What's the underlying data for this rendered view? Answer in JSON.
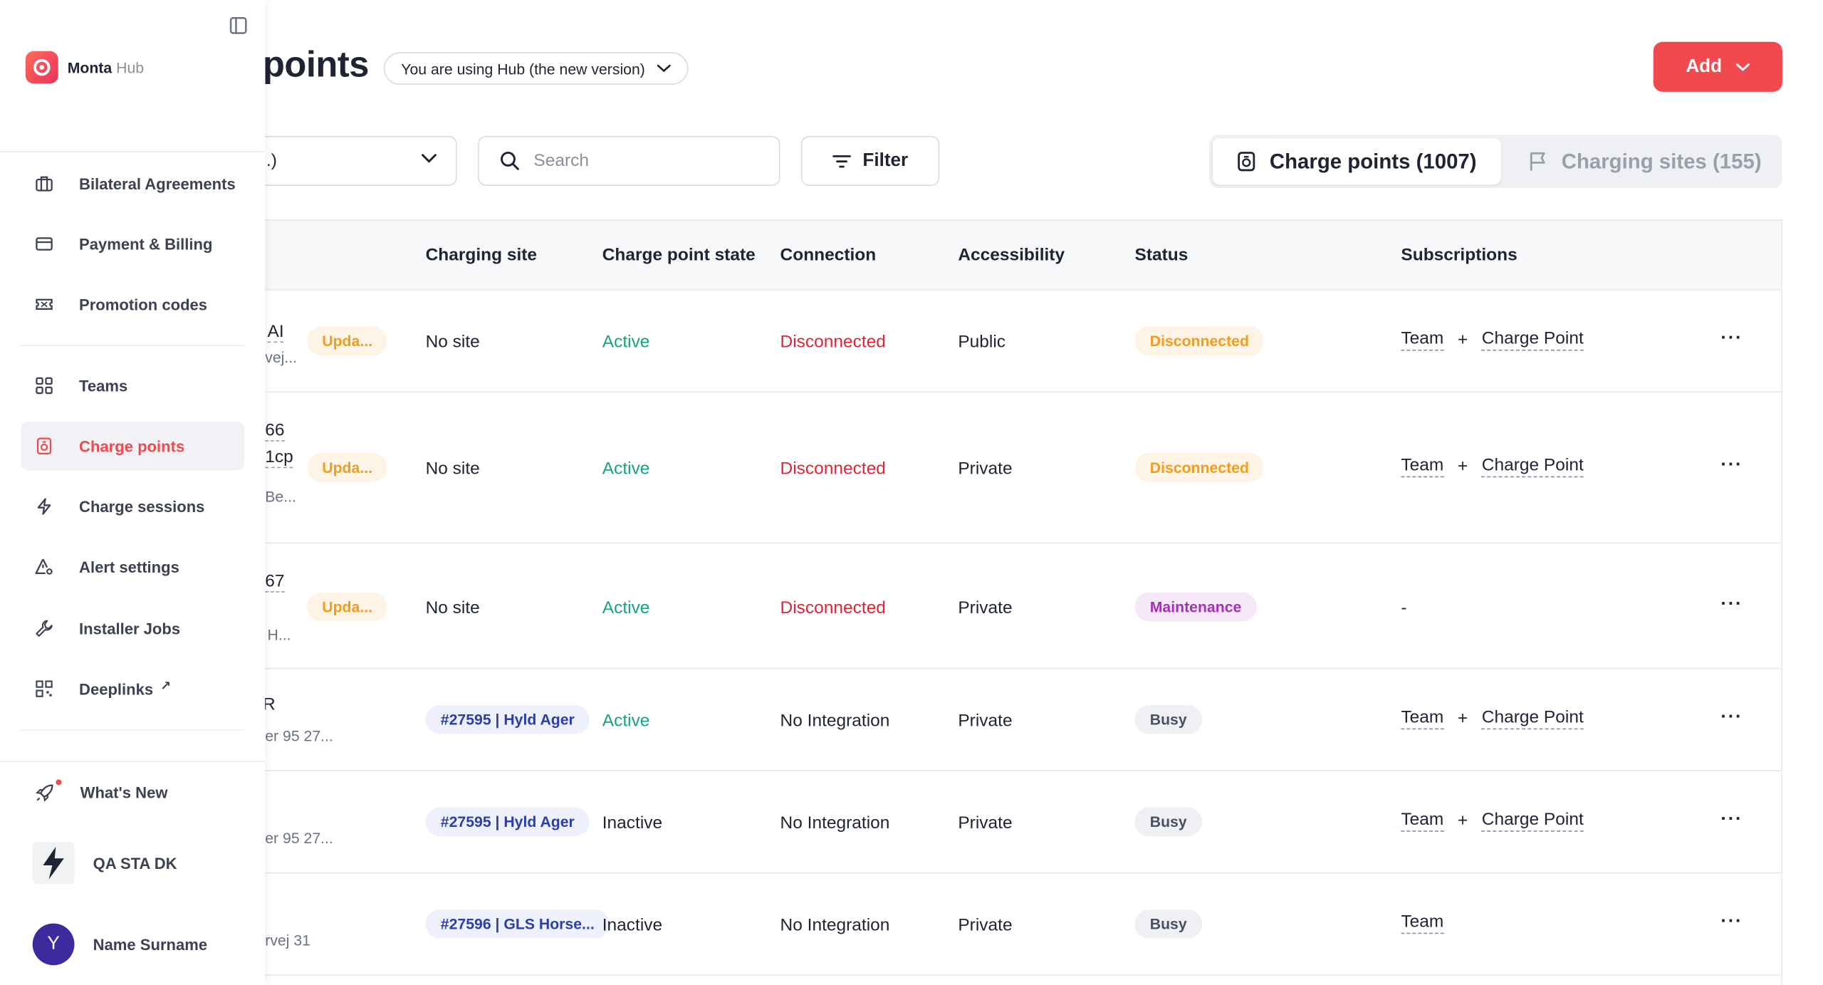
{
  "header": {
    "title": "points",
    "version_label": "You are using Hub (the new version)",
    "add_label": "Add"
  },
  "toolbar": {
    "select_value": ".)",
    "search_placeholder": "Search",
    "filter_label": "Filter",
    "tab_charge_points": "Charge points (1007)",
    "tab_charging_sites": "Charging sites (155)"
  },
  "table": {
    "columns": [
      "Charging site",
      "Charge point state",
      "Connection",
      "Accessibility",
      "Status",
      "Subscriptions"
    ],
    "plus": "+",
    "more": "···",
    "rows": [
      {
        "frag_a": "AI",
        "frag_b": "vej...",
        "update": "Upda...",
        "site": "No site",
        "state": "Active",
        "connection": "Disconnected",
        "access": "Public",
        "status": "Disconnected",
        "sub1": "Team",
        "sub2": "Charge Point"
      },
      {
        "frag_a": "66",
        "frag_b": "1cp",
        "frag_c": "Be...",
        "update": "Upda...",
        "site": "No site",
        "state": "Active",
        "connection": "Disconnected",
        "access": "Private",
        "status": "Disconnected",
        "sub1": "Team",
        "sub2": "Charge Point"
      },
      {
        "frag_a": "67",
        "frag_b": "H...",
        "update": "Upda...",
        "site": "No site",
        "state": "Active",
        "connection": "Disconnected",
        "access": "Private",
        "status": "Maintenance",
        "sub_dash": "-"
      },
      {
        "frag_a": "R",
        "frag_b": "er 95 27...",
        "site": "#27595 | Hyld Ager",
        "state": "Active",
        "connection": "No Integration",
        "access": "Private",
        "status": "Busy",
        "sub1": "Team",
        "sub2": "Charge Point"
      },
      {
        "frag_b": "er 95 27...",
        "site": "#27595 | Hyld Ager",
        "state": "Inactive",
        "connection": "No Integration",
        "access": "Private",
        "status": "Busy",
        "sub1": "Team",
        "sub2": "Charge Point"
      },
      {
        "frag_b": "rvej 31",
        "site": "#27596 | GLS Horse...",
        "state": "Inactive",
        "connection": "No Integration",
        "access": "Private",
        "status": "Busy",
        "sub1": "Team"
      }
    ]
  },
  "sidebar": {
    "brand": "Monta",
    "brand_suffix": "Hub",
    "items": [
      {
        "label": "Bilateral Agreements",
        "icon": "briefcase-icon"
      },
      {
        "label": "Payment & Billing",
        "icon": "credit-card-icon"
      },
      {
        "label": "Promotion codes",
        "icon": "ticket-icon"
      },
      {
        "label": "Teams",
        "icon": "grid-icon"
      },
      {
        "label": "Charge points",
        "icon": "charger-icon",
        "active": true
      },
      {
        "label": "Charge sessions",
        "icon": "lightning-icon"
      },
      {
        "label": "Alert settings",
        "icon": "alert-gear-icon"
      },
      {
        "label": "Installer Jobs",
        "icon": "wrench-icon"
      },
      {
        "label": "Deeplinks",
        "icon": "qr-code-icon",
        "external": "↗"
      }
    ],
    "whats_new": "What's New",
    "org_name": "QA STA DK",
    "user_name": "Name Surname",
    "user_initial": "Y"
  },
  "colors": {
    "accent": "#f04a4f",
    "active_state": "#14a37f",
    "disconnected": "#e02434",
    "warning_badge": "#f39c1e",
    "maintenance_badge": "#a232b5",
    "site_badge": "#2a3fa8"
  }
}
